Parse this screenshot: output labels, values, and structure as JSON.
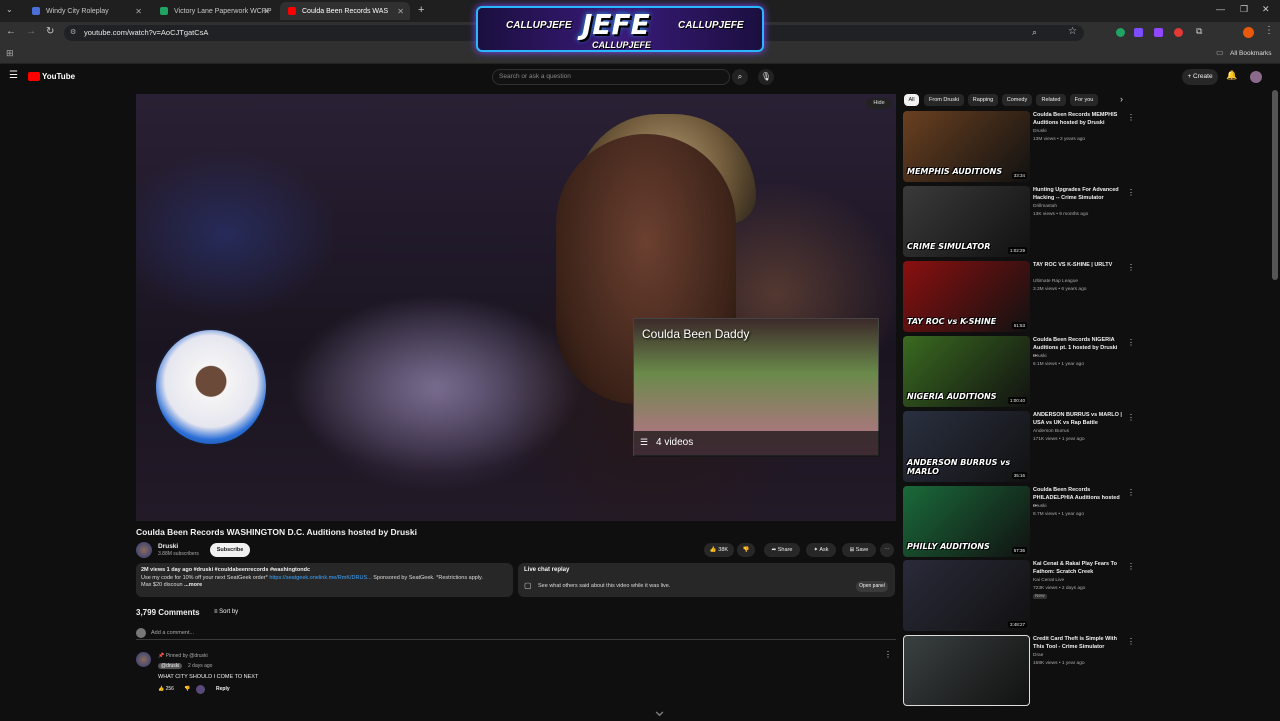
{
  "tabs": [
    {
      "title": "Windy City Roleplay",
      "color": "#4a6fd8"
    },
    {
      "title": "Victory Lane Paperwork WCRP",
      "color": "#1fa463"
    },
    {
      "title": "Coulda Been Records WAS",
      "color": "#ff0000"
    }
  ],
  "address": "youtube.com/watch?v=AoCJTgatCsA",
  "bookmarks_label": "All Bookmarks",
  "overlay": {
    "name": "JEFE",
    "handle1": "CALLUPJEFE",
    "handle2": "CALLUPJEFE",
    "handle3": "CALLUPJEFE"
  },
  "youtube": {
    "logo": "YouTube",
    "search_placeholder": "Search or ask a question",
    "create": "Create"
  },
  "player": {
    "hide": "Hide"
  },
  "playlist": {
    "title": "Coulda Been Daddy",
    "count": "4 videos"
  },
  "video": {
    "title": "Coulda Been Records WASHINGTON D.C. Auditions hosted by Druski",
    "channel": "Druski",
    "subs": "3.88M subscribers",
    "subscribe": "Subscribe",
    "likes": "38K",
    "share": "Share",
    "ask": "Ask",
    "save": "Save",
    "desc_line1": "2M views  1 day ago  #druski #couldabeenrecords #washingtondc",
    "desc_line2": "Use my code for 10% off your next SeatGeek order*",
    "desc_link": "https://seatgeek.onelink.me/RmK/DRUS...",
    "desc_sponsor": "Sponsored by SeatGeek. *Restrictions apply.",
    "desc_line3": "Max $20 discoun",
    "more": "...more"
  },
  "livechat": {
    "title": "Live chat replay",
    "subtitle": "See what others said about this video while it was live.",
    "open": "Open panel"
  },
  "comments": {
    "count": "3,799 Comments",
    "sort": "Sort by",
    "add": "Add a comment...",
    "pinned": "Pinned by @druski",
    "author": "@druski",
    "time": "2 days ago",
    "text": "WHAT CITY SHOULD I COME TO NEXT",
    "likes": "256",
    "reply": "Reply"
  },
  "chips": [
    "All",
    "From Druski",
    "Rapping",
    "Comedy",
    "Related",
    "For you"
  ],
  "recommendations": [
    {
      "title": "Coulda Been Records MEMPHIS Auditions hosted by Druski",
      "channel": "Druski",
      "meta": "13M views • 2 years ago",
      "duration": "33:34",
      "label": "MEMPHIS AUDITIONS",
      "bg": "#6a4020"
    },
    {
      "title": "Hunting Upgrades For Advanced Hacking -- Crime Simulator",
      "channel": "Drillmastah",
      "meta": "13K views • 9 months ago",
      "duration": "1:02:29",
      "label": "CRIME SIMULATOR",
      "bg": "#3a3a3a"
    },
    {
      "title": "TAY ROC VS K-SHINE | URLTV",
      "channel": "Ultimate Rap League",
      "meta": "3.3M views • 6 years ago",
      "duration": "51:53",
      "label": "TAY ROC vs K-SHINE",
      "bg": "#8a1010"
    },
    {
      "title": "Coulda Been Records NIGERIA Auditions pt. 1 hosted by Druski ...",
      "channel": "Druski",
      "meta": "6.1M views • 1 year ago",
      "duration": "1:00:40",
      "label": "NIGERIA AUDITIONS",
      "bg": "#3a6a20"
    },
    {
      "title": "ANDERSON BURRUS vs MARLO | USA vs UK vs Rap Battle",
      "channel": "Anderson Burrus",
      "meta": "171K views • 1 year ago",
      "duration": "35:16",
      "label": "ANDERSON BURRUS vs MARLO",
      "bg": "#2a3040"
    },
    {
      "title": "Coulda Been Records PHILADELPHIA Auditions hosted ...",
      "channel": "Druski",
      "meta": "8.7M views • 1 year ago",
      "duration": "57:36",
      "label": "PHILLY AUDITIONS",
      "bg": "#1a6a3a"
    },
    {
      "title": "Kai Cenat & Rakai Play Fears To Fathom: Scratch Creek",
      "channel": "Kai Cenat Live",
      "meta": "723K views • 2 days ago",
      "badge": "New",
      "duration": "3:48:27",
      "label": "",
      "bg": "#2a2a3a"
    },
    {
      "title": "Credit Card Theft is Simple With This Tool - Crime Simulator",
      "channel": "Drae",
      "meta": "168K views • 1 year ago",
      "duration": "",
      "label": "",
      "bg": "#3a4040"
    }
  ]
}
